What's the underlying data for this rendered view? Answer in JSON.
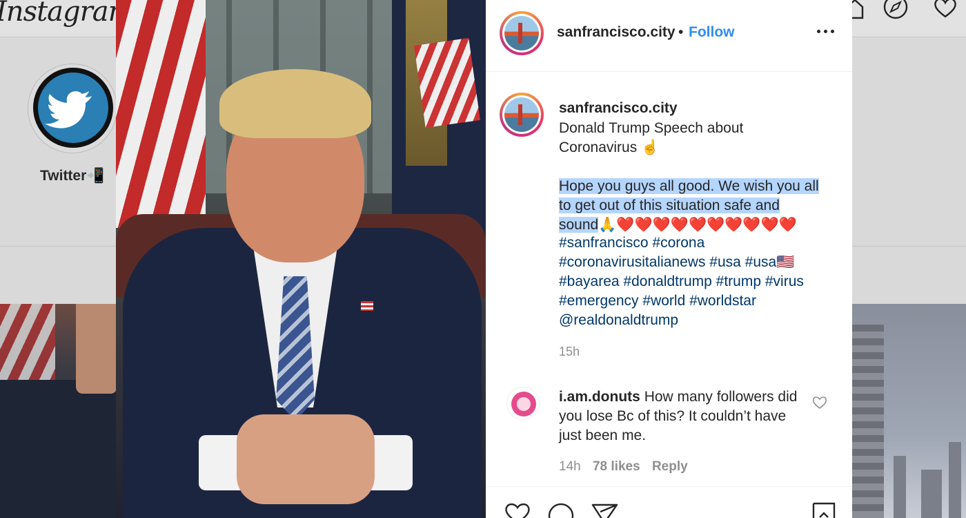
{
  "background": {
    "logo_text": "Instagram",
    "highlight_label": "Twitter📲"
  },
  "post": {
    "username": "sanfrancisco.city",
    "separator": "•",
    "follow_label": "Follow",
    "caption": {
      "username": "sanfrancisco.city",
      "line1": "Donald Trump Speech about Coronavirus ☝️",
      "highlighted": "Hope you guys all good. We wish you all to get out of this situation safe and sound",
      "after_highlight": "🙏❤️❤️❤️❤️❤️❤️❤️❤️❤️❤️",
      "hashtags": "#sanfrancisco #corona #coronavirusitalianews #usa #usa🇺🇸 #bayarea #donaldtrump #trump #virus #emergency #world #worldstar @realdonaldtrump",
      "time": "15h"
    },
    "comment": {
      "username": "i.am.donuts",
      "text": "How many followers did you lose Bc of this? It couldn’t have just been me.",
      "time": "14h",
      "likes": "78 likes",
      "reply_label": "Reply"
    }
  },
  "icons": {
    "header_more": "more-horizontal-icon",
    "comment_like": "heart-outline-icon",
    "action_like": "heart-outline-icon",
    "action_comment": "comment-bubble-icon",
    "action_share": "paper-plane-icon",
    "action_save": "bookmark-icon"
  },
  "colors": {
    "follow_blue": "#2f8ef0",
    "hashtag_blue": "#00376b",
    "selection_highlight": "#b4d5fe"
  }
}
